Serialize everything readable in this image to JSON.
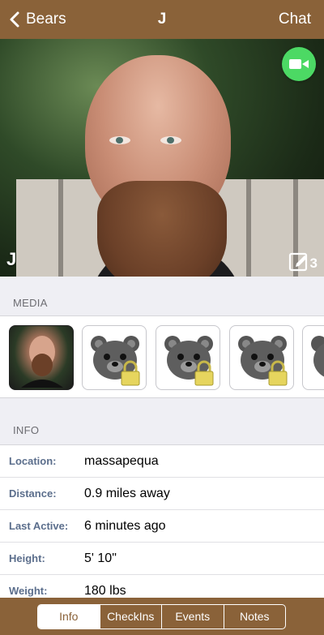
{
  "colors": {
    "brand": "#8a6239",
    "video_button": "#4cd964",
    "label": "#5b6e8c"
  },
  "nav": {
    "back_label": "Bears",
    "title": "J",
    "chat_label": "Chat"
  },
  "profile": {
    "display_name": "J",
    "photo_count": "3"
  },
  "media": {
    "header": "MEDIA",
    "items": [
      {
        "type": "photo",
        "locked": false
      },
      {
        "type": "bear-placeholder",
        "locked": true
      },
      {
        "type": "bear-placeholder",
        "locked": true
      },
      {
        "type": "bear-placeholder",
        "locked": true
      },
      {
        "type": "bear-placeholder",
        "locked": true
      }
    ]
  },
  "info": {
    "header": "INFO",
    "rows": [
      {
        "label": "Location:",
        "value": "massapequa"
      },
      {
        "label": "Distance:",
        "value": "0.9 miles away"
      },
      {
        "label": "Last Active:",
        "value": "6 minutes ago"
      },
      {
        "label": "Height:",
        "value": "5' 10\""
      },
      {
        "label": "Weight:",
        "value": "180 lbs"
      }
    ]
  },
  "tabs": {
    "items": [
      "Info",
      "CheckIns",
      "Events",
      "Notes"
    ],
    "selected": "Info"
  }
}
